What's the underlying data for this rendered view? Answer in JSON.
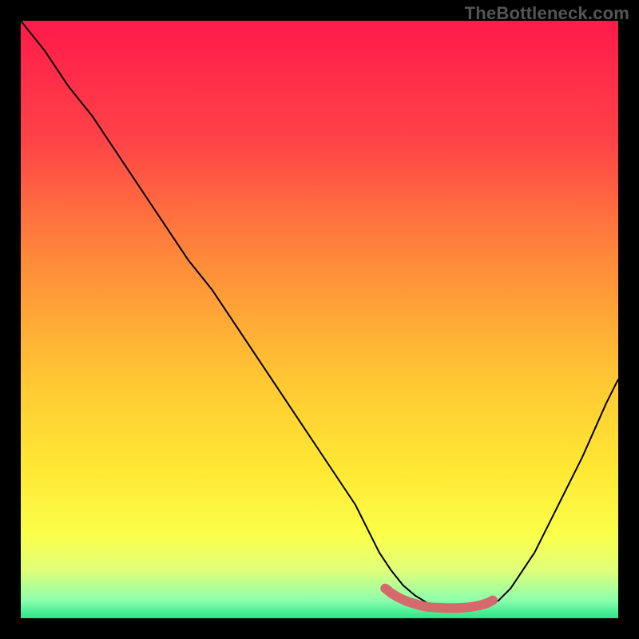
{
  "watermark": {
    "text": "TheBottleneck.com"
  },
  "chart_data": {
    "type": "line",
    "title": "",
    "subtitle": "",
    "xlabel": "",
    "ylabel": "",
    "xlim": [
      0,
      100
    ],
    "ylim": [
      0,
      100
    ],
    "grid": false,
    "legend": false,
    "annotations": [],
    "background_gradient_stops": [
      {
        "offset": 0,
        "color": "#ff1a4b"
      },
      {
        "offset": 20,
        "color": "#ff4347"
      },
      {
        "offset": 40,
        "color": "#ff8a3a"
      },
      {
        "offset": 60,
        "color": "#ffc733"
      },
      {
        "offset": 75,
        "color": "#ffe833"
      },
      {
        "offset": 86,
        "color": "#fbff4a"
      },
      {
        "offset": 92,
        "color": "#e0ff7a"
      },
      {
        "offset": 97,
        "color": "#8dffad"
      },
      {
        "offset": 100,
        "color": "#29e58a"
      }
    ],
    "series": [
      {
        "name": "curve",
        "color": "#000000",
        "width": 2,
        "x": [
          0,
          4,
          8,
          12,
          16,
          20,
          24,
          28,
          32,
          36,
          40,
          44,
          48,
          52,
          56,
          60,
          62,
          64,
          66,
          68,
          70,
          72,
          74,
          76,
          78,
          80,
          82,
          86,
          90,
          94,
          98,
          100
        ],
        "values": [
          100,
          95,
          89,
          84,
          78,
          72,
          66,
          60,
          55,
          49,
          43,
          37,
          31,
          25,
          19,
          11,
          8,
          5.5,
          3.8,
          2.6,
          1.8,
          1.4,
          1.3,
          1.4,
          1.8,
          3,
          5,
          11,
          19,
          27,
          36,
          40
        ]
      },
      {
        "name": "marker",
        "color": "#d66a6a",
        "width": 12,
        "linecap": "round",
        "x": [
          61,
          62,
          63,
          64,
          65,
          66,
          67,
          68,
          69,
          70,
          71,
          72,
          73,
          74,
          75,
          76,
          77,
          78,
          79
        ],
        "values": [
          5.0,
          4.2,
          3.6,
          3.1,
          2.7,
          2.4,
          2.1,
          1.9,
          1.8,
          1.75,
          1.7,
          1.7,
          1.7,
          1.75,
          1.85,
          2.0,
          2.2,
          2.5,
          3.0
        ]
      }
    ]
  }
}
